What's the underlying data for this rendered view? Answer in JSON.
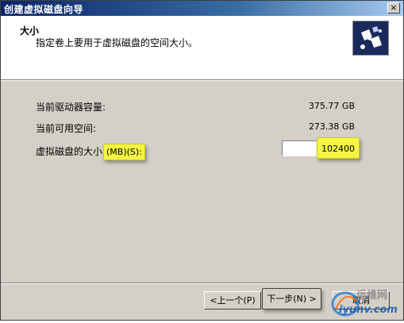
{
  "window": {
    "title": "创建虚拟磁盘向导",
    "close_label": "×"
  },
  "header": {
    "title": "大小",
    "description": "指定卷上要用于虚拟磁盘的空间大小。",
    "logo_icon": "disk-wizard-icon"
  },
  "fields": {
    "current_capacity_label": "当前驱动器容量:",
    "current_capacity_value": "375.77 GB",
    "current_free_label": "当前可用空间:",
    "current_free_value": "273.38 GB",
    "size_label_prefix": "虚拟磁盘的大小",
    "size_label_highlight": "(MB)(S):",
    "size_value": "102400"
  },
  "buttons": {
    "back": "<上一个(P)",
    "next": "下一步(N) >",
    "cancel": "取消"
  },
  "watermark": {
    "text": "运维网",
    "url": "iyunv.com"
  },
  "colors": {
    "title_bar": "#0a246a",
    "highlight": "#f5f542",
    "face": "#d4d0c8"
  }
}
